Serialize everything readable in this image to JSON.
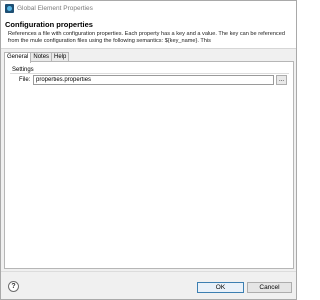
{
  "window": {
    "title": "Global Element Properties"
  },
  "header": {
    "title": "Configuration properties",
    "description": "References a file with configuration properties. Each property has a key and a value. The key can be referenced from the mule configuration files using the following semantics: ${key_name}. This"
  },
  "tabs": [
    {
      "label": "General",
      "active": true
    },
    {
      "label": "Notes",
      "active": false
    },
    {
      "label": "Help",
      "active": false
    }
  ],
  "settings": {
    "group_label": "Settings",
    "file_label": "File:",
    "file_value": "properties.properties",
    "browse_label": "..."
  },
  "footer": {
    "help_label": "?",
    "ok_label": "OK",
    "cancel_label": "Cancel"
  },
  "colors": {
    "accent": "#3c7fb1",
    "dialog_bg": "#f0f0f0"
  }
}
